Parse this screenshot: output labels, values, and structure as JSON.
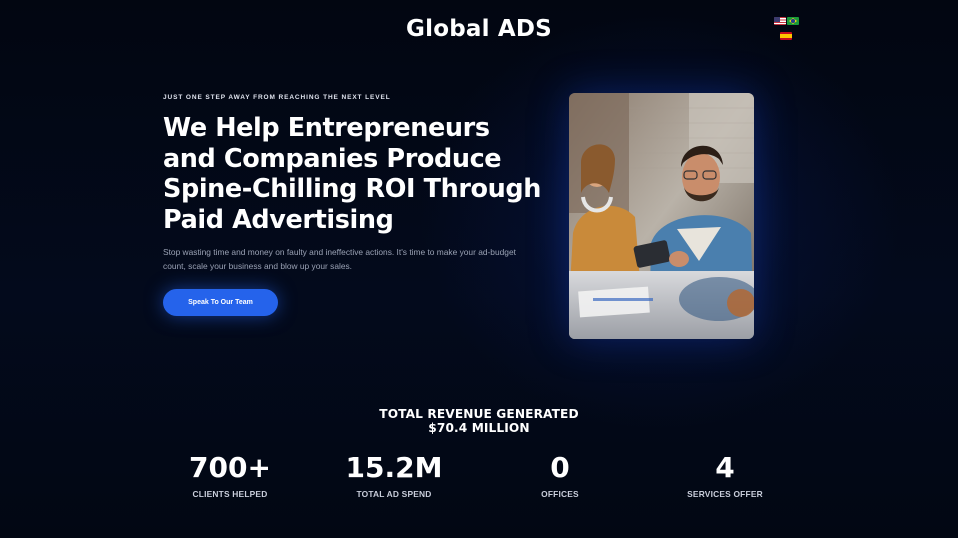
{
  "header": {
    "logo": "Global ADS",
    "flags": [
      "us-flag-icon",
      "brazil-flag-icon",
      "spain-flag-icon"
    ]
  },
  "hero": {
    "eyebrow": "JUST ONE STEP AWAY FROM REACHING THE NEXT LEVEL",
    "headline": "We Help Entrepreneurs and Companies Produce Spine-Chilling ROI Through Paid Advertising",
    "subtext": "Stop wasting time and money on faulty and ineffective actions. It's time to make your ad-budget count, scale your business and blow up your sales.",
    "cta_label": "Speak To Our Team",
    "accent": "#2563eb"
  },
  "stats": {
    "revenue_line1": "TOTAL REVENUE GENERATED",
    "revenue_line2": "$70.4 MILLION",
    "items": [
      {
        "value": "700+",
        "label": "CLIENTS HELPED"
      },
      {
        "value": "15.2M",
        "label": "TOTAL AD SPEND"
      },
      {
        "value": "0",
        "label": "OFFICES"
      },
      {
        "value": "4",
        "label": "SERVICES OFFER"
      }
    ]
  }
}
